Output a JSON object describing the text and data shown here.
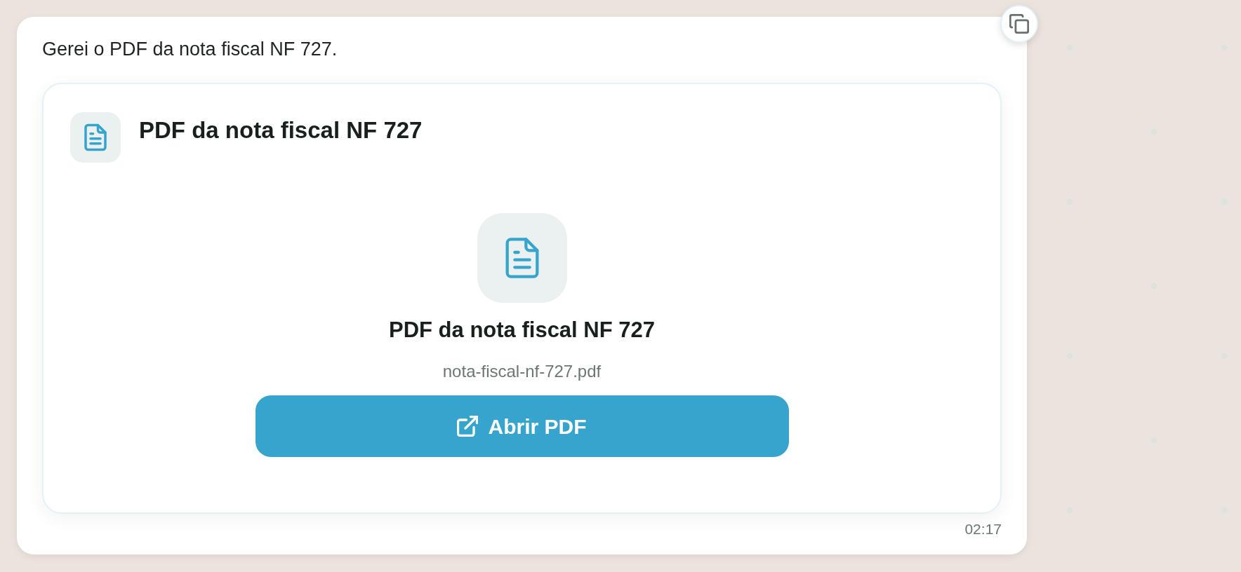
{
  "message": {
    "text": "Gerei o PDF da nota fiscal NF 727.",
    "time": "02:17"
  },
  "attachment": {
    "header_title": "PDF da nota fiscal NF 727",
    "title": "PDF da nota fiscal NF 727",
    "filename": "nota-fiscal-nf-727.pdf",
    "button": {
      "label": "Abrir PDF"
    }
  }
}
